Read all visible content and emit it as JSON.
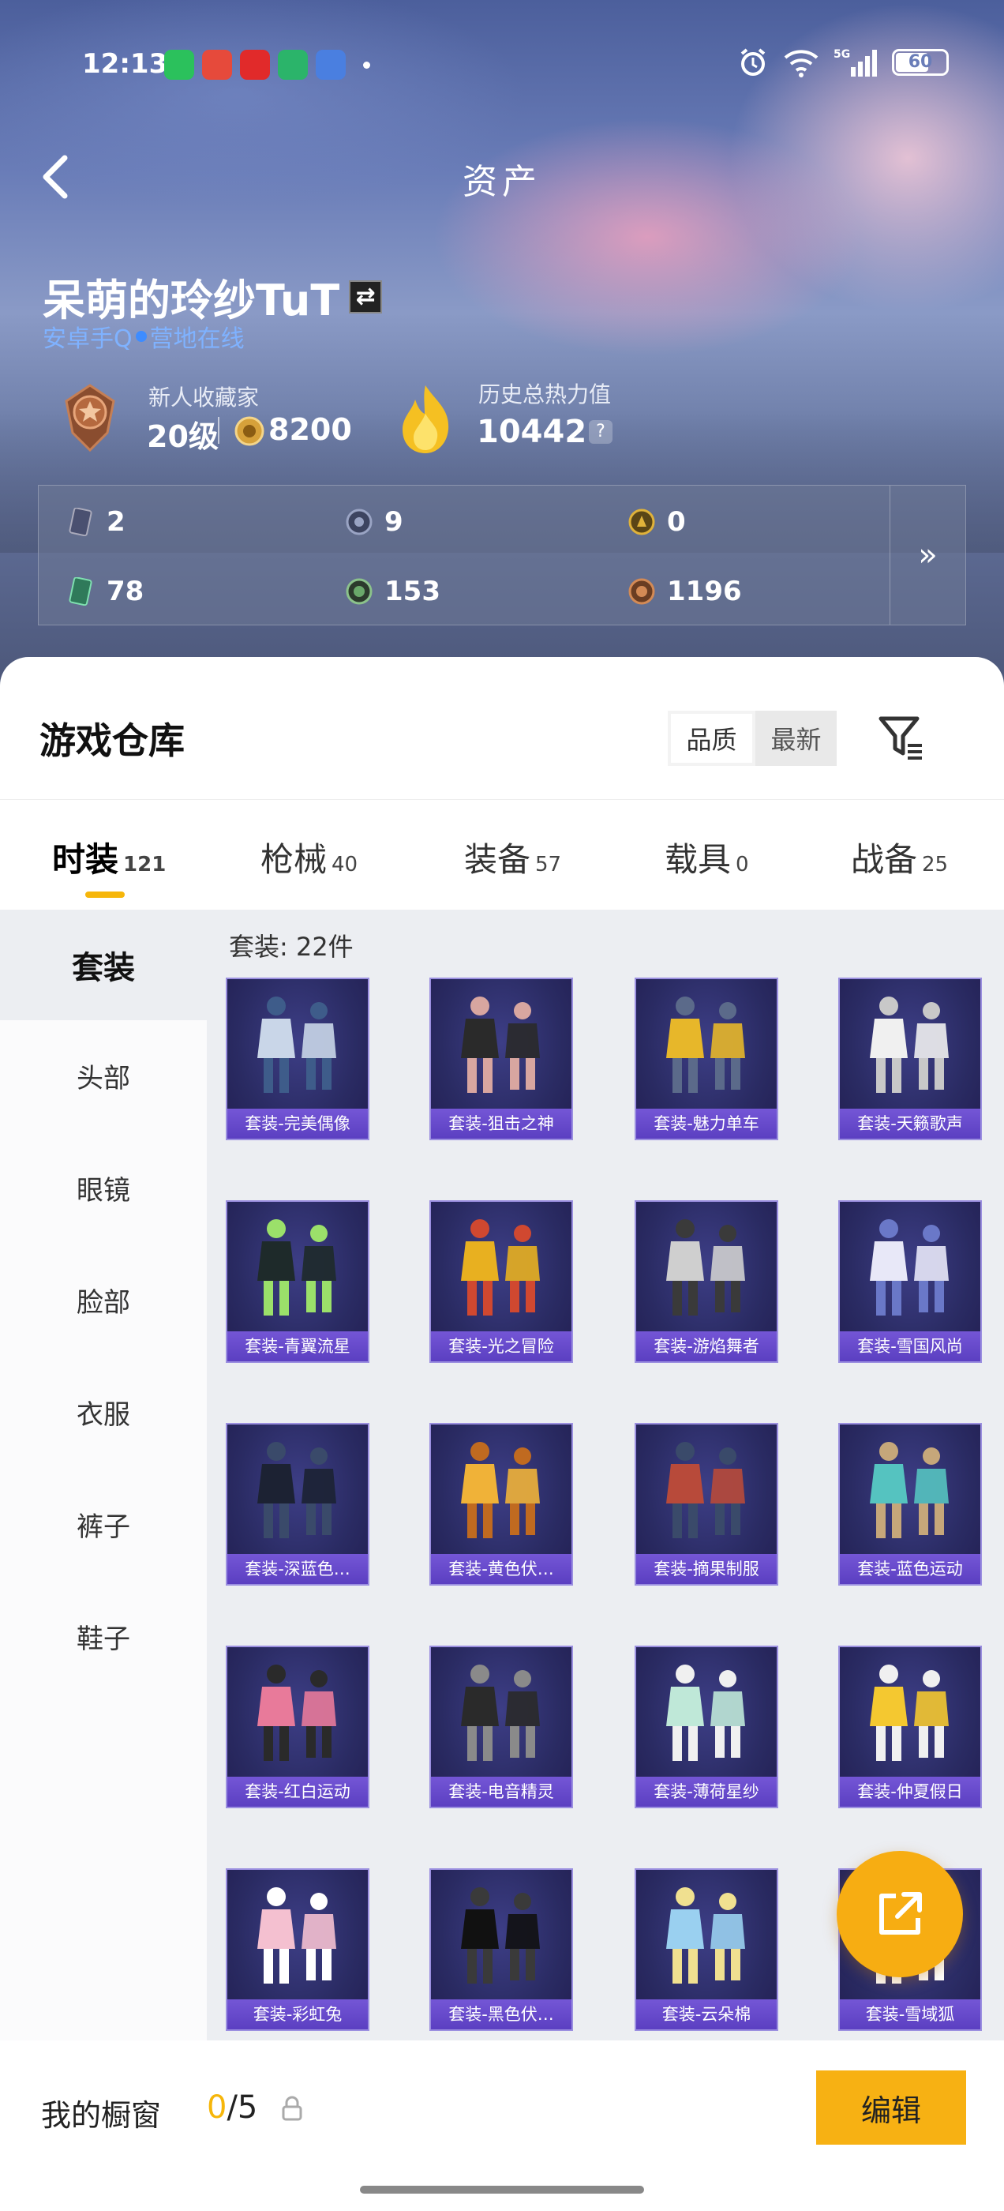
{
  "status_bar": {
    "time": "12:13",
    "battery": "60",
    "network": "5G",
    "apps": [
      {
        "name": "wechat-icon",
        "color": "#2bc15c"
      },
      {
        "name": "app-red-icon",
        "color": "#e64a3b"
      },
      {
        "name": "netease-music-icon",
        "color": "#e12a2a"
      },
      {
        "name": "oppo-store-icon",
        "color": "#2bb46a"
      },
      {
        "name": "game-app-icon",
        "color": "#4a7fe0"
      }
    ]
  },
  "header": {
    "title": "资产"
  },
  "player": {
    "name": "呆萌的玲纱TuT",
    "platform": "安卓手Q",
    "status": "营地在线",
    "rank_title": "新人收藏家",
    "level": "20级",
    "coins": "8200",
    "heat_label": "历史总热力值",
    "heat_value": "10442",
    "help": "?"
  },
  "stats": [
    {
      "icon": "card-icon",
      "value": "2"
    },
    {
      "icon": "silver-coin-icon",
      "value": "9"
    },
    {
      "icon": "gold-coin-icon",
      "value": "0"
    },
    {
      "icon": "ticket-icon",
      "value": "78"
    },
    {
      "icon": "green-coin-icon",
      "value": "153"
    },
    {
      "icon": "bronze-coin-icon",
      "value": "1196"
    }
  ],
  "warehouse": {
    "title": "游戏仓库",
    "sort": {
      "quality": "品质",
      "latest": "最新"
    },
    "tabs": [
      {
        "label": "时装",
        "count": "121"
      },
      {
        "label": "枪械",
        "count": "40"
      },
      {
        "label": "装备",
        "count": "57"
      },
      {
        "label": "载具",
        "count": "0"
      },
      {
        "label": "战备",
        "count": "25"
      }
    ],
    "sidebar": [
      "套装",
      "头部",
      "眼镜",
      "脸部",
      "衣服",
      "裤子",
      "鞋子"
    ],
    "grid_header": "套装: 22件",
    "items": [
      "套装-完美偶像",
      "套装-狙击之神",
      "套装-魅力单车",
      "套装-天籁歌声",
      "套装-青翼流星",
      "套装-光之冒险",
      "套装-游焰舞者",
      "套装-雪国风尚",
      "套装-深蓝色…",
      "套装-黄色伏…",
      "套装-摘果制服",
      "套装-蓝色运动",
      "套装-红白运动",
      "套装-电音精灵",
      "套装-薄荷星纱",
      "套装-仲夏假日",
      "套装-彩虹兔",
      "套装-黑色伏…",
      "套装-云朵棉",
      "套装-雪域狐"
    ]
  },
  "bottom": {
    "showcase_label": "我的橱窗",
    "showcase_current": "0",
    "showcase_total": "/5",
    "edit": "编辑"
  },
  "colors": {
    "accent": "#f6b60a",
    "card_label": "#5b3fc1",
    "online": "#3e8cff"
  }
}
